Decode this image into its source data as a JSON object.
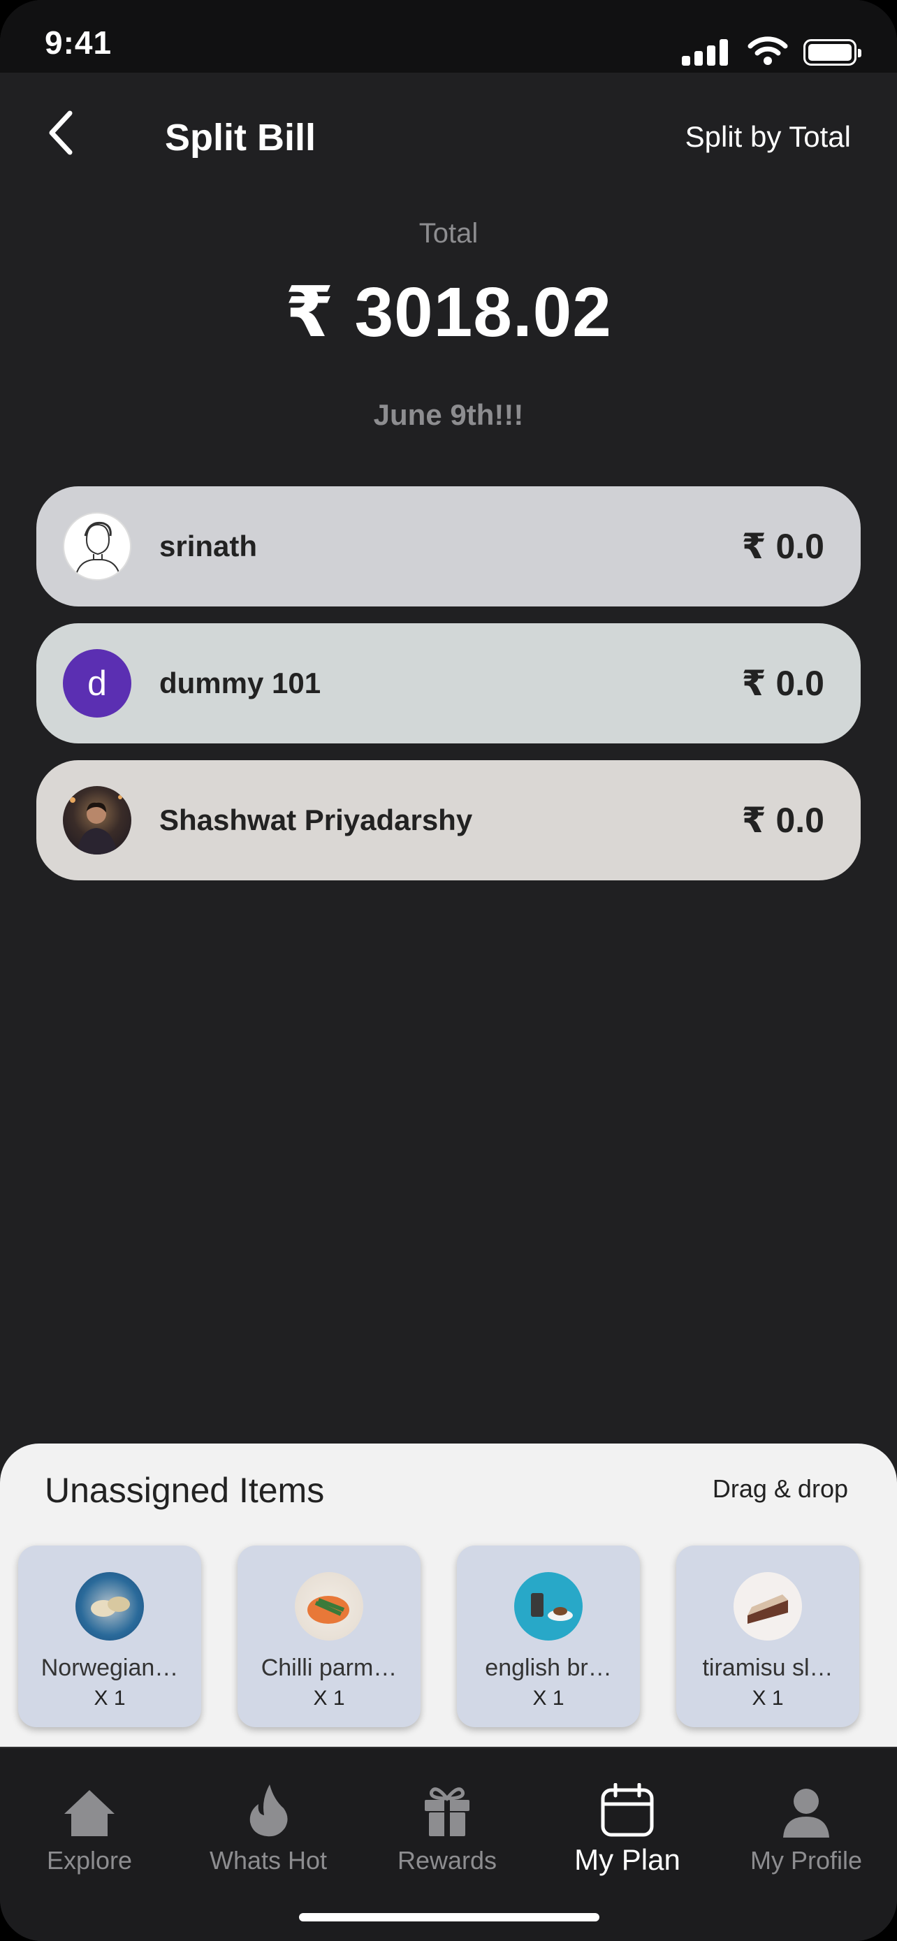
{
  "status": {
    "time": "9:41"
  },
  "header": {
    "title": "Split Bill",
    "split_mode": "Split by Total"
  },
  "summary": {
    "total_label": "Total",
    "total_amount": "₹ 3018.02",
    "event_name": "June 9th!!!"
  },
  "people": [
    {
      "name": "srinath",
      "amount": "₹ 0.0",
      "avatar": "sketch-avatar",
      "card_color": "#d0d1d5"
    },
    {
      "name": "dummy 101",
      "amount": "₹ 0.0",
      "avatar_letter": "d",
      "avatar_color": "#5b2fb2",
      "card_color": "#d2d7d7"
    },
    {
      "name": "Shashwat Priyadarshy",
      "amount": "₹ 0.0",
      "avatar": "photo-avatar",
      "card_color": "#dad7d4"
    }
  ],
  "unassigned": {
    "title": "Unassigned Items",
    "hint": "Drag & drop",
    "items": [
      {
        "name": "Norwegian…",
        "qty": "X 1"
      },
      {
        "name": "Chilli parm…",
        "qty": "X 1"
      },
      {
        "name": "english br…",
        "qty": "X 1"
      },
      {
        "name": "tiramisu sl…",
        "qty": "X 1"
      }
    ]
  },
  "tabs": [
    {
      "label": "Explore",
      "icon": "home-icon",
      "active": false
    },
    {
      "label": "Whats Hot",
      "icon": "flame-icon",
      "active": false
    },
    {
      "label": "Rewards",
      "icon": "gift-icon",
      "active": false
    },
    {
      "label": "My Plan",
      "icon": "calendar-icon",
      "active": true
    },
    {
      "label": "My Profile",
      "icon": "person-icon",
      "active": false
    }
  ]
}
